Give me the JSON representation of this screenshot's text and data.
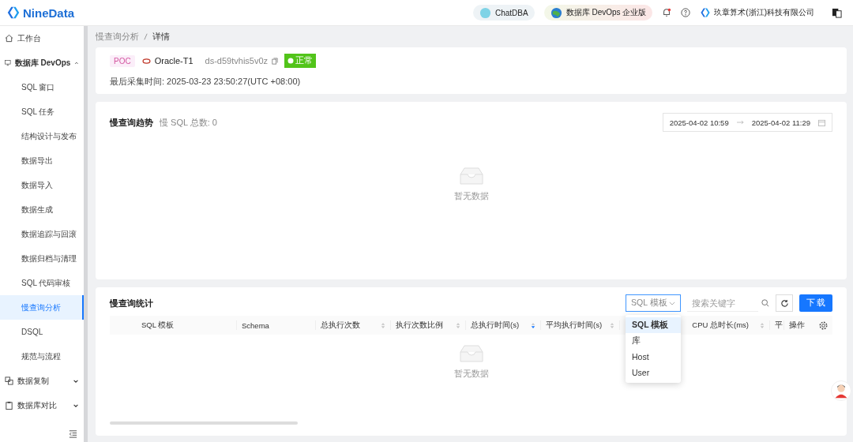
{
  "header": {
    "logo": "NineData",
    "chat": "ChatDBA",
    "edition": "数据库 DevOps 企业版",
    "company": "玖章算术(浙江)科技有限公司"
  },
  "sidebar": {
    "items": [
      {
        "label": "工作台",
        "expanded": false
      },
      {
        "label": "数据库 DevOps",
        "expanded": true,
        "children": [
          {
            "label": "SQL 窗口",
            "selected": false
          },
          {
            "label": "SQL 任务",
            "selected": false
          },
          {
            "label": "结构设计与发布",
            "selected": false
          },
          {
            "label": "数据导出",
            "selected": false
          },
          {
            "label": "数据导入",
            "selected": false
          },
          {
            "label": "数据生成",
            "selected": false
          },
          {
            "label": "数据追踪与回滚",
            "selected": false
          },
          {
            "label": "数据归档与清理",
            "selected": false
          },
          {
            "label": "SQL 代码审核",
            "selected": false
          },
          {
            "label": "慢查询分析",
            "selected": true
          },
          {
            "label": "DSQL",
            "selected": false
          },
          {
            "label": "规范与流程",
            "selected": false
          }
        ]
      },
      {
        "label": "数据复制",
        "expanded": false
      },
      {
        "label": "数据库对比",
        "expanded": false
      }
    ]
  },
  "breadcrumb": [
    "慢查询分析",
    "详情"
  ],
  "instance": {
    "tag": "POC",
    "name": "Oracle-T1",
    "id": "ds-d59tvhis5v0z",
    "status": "正常",
    "collected": "最后采集时间: 2025-03-23 23:50:27(UTC +08:00)"
  },
  "trend": {
    "title": "慢查询趋势",
    "count": "慢 SQL 总数: 0",
    "start": "2025-04-02 10:59",
    "end": "2025-04-02 11:29",
    "empty": "暂无数据"
  },
  "stats": {
    "title": "慢查询统计",
    "filter": "SQL 模板",
    "placeholder": "搜索关键字",
    "download": "下 载",
    "empty": "暂无数据",
    "columns": [
      {
        "label": "SQL 模板"
      },
      {
        "label": "Schema"
      },
      {
        "label": "总执行次数",
        "sorted": false
      },
      {
        "label": "执行次数比例",
        "sorted": false
      },
      {
        "label": "总执行时间(s)",
        "sorted": true
      },
      {
        "label": "平均执行时间(s)",
        "sorted": false
      },
      {
        "label": "CPU 总时长(ms)",
        "sorted": false
      },
      {
        "label": "平"
      }
    ],
    "action_column": "操作",
    "dropdown": [
      {
        "label": "SQL 模板",
        "selected": true
      },
      {
        "label": "库",
        "selected": false
      },
      {
        "label": "Host",
        "selected": false
      },
      {
        "label": "User",
        "selected": false
      }
    ]
  }
}
